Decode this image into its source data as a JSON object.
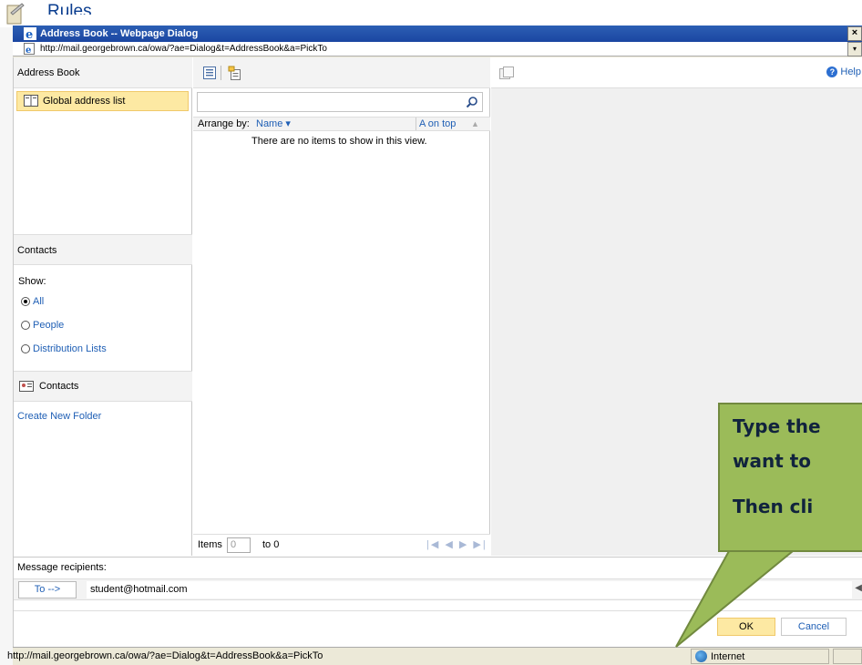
{
  "background": {
    "app_title": "Rules"
  },
  "window": {
    "title": "Address Book -- Webpage Dialog",
    "close_glyph": "×",
    "url": "http://mail.georgebrown.ca/owa/?ae=Dialog&t=AddressBook&a=PickTo",
    "dropdown_glyph": "▾"
  },
  "sidebar": {
    "address_book_header": "Address Book",
    "global_address_list": "Global address list",
    "contacts_header": "Contacts",
    "show_label": "Show:",
    "filters": [
      {
        "label": "All",
        "selected": true
      },
      {
        "label": "People",
        "selected": false
      },
      {
        "label": "Distribution Lists",
        "selected": false
      }
    ],
    "contacts_folder": "Contacts",
    "create_new_folder": "Create New Folder"
  },
  "list": {
    "search_value": "",
    "arrange_by_label": "Arrange by:",
    "arrange_by_value": "Name ▾",
    "sort_order": "A on top",
    "sort_arrow": "▲",
    "empty_message": "There are no items to show in this view.",
    "pager": {
      "items_label": "Items",
      "current": "0",
      "to_label": "to 0",
      "nav_glyphs": "|◀ ◀ ▶ ▶|"
    }
  },
  "reading_pane": {
    "help_label": "Help",
    "help_glyph": "?"
  },
  "callout": {
    "line1": "Type the",
    "line2": "want to",
    "line3": "Then cli"
  },
  "recipients": {
    "label": "Message recipients:",
    "to_button": "To -->",
    "to_value": "student@hotmail.com",
    "scroll_glyph": "◀"
  },
  "actions": {
    "ok": "OK",
    "cancel": "Cancel"
  },
  "status_bar": {
    "url": "http://mail.georgebrown.ca/owa/?ae=Dialog&t=AddressBook&a=PickTo",
    "zone": "Internet"
  },
  "colors": {
    "titlebar": "#1b46a2",
    "selected_bg": "#fde9a3",
    "link": "#1f5fb5",
    "callout_bg": "#9bbb59",
    "callout_text": "#11233d"
  }
}
